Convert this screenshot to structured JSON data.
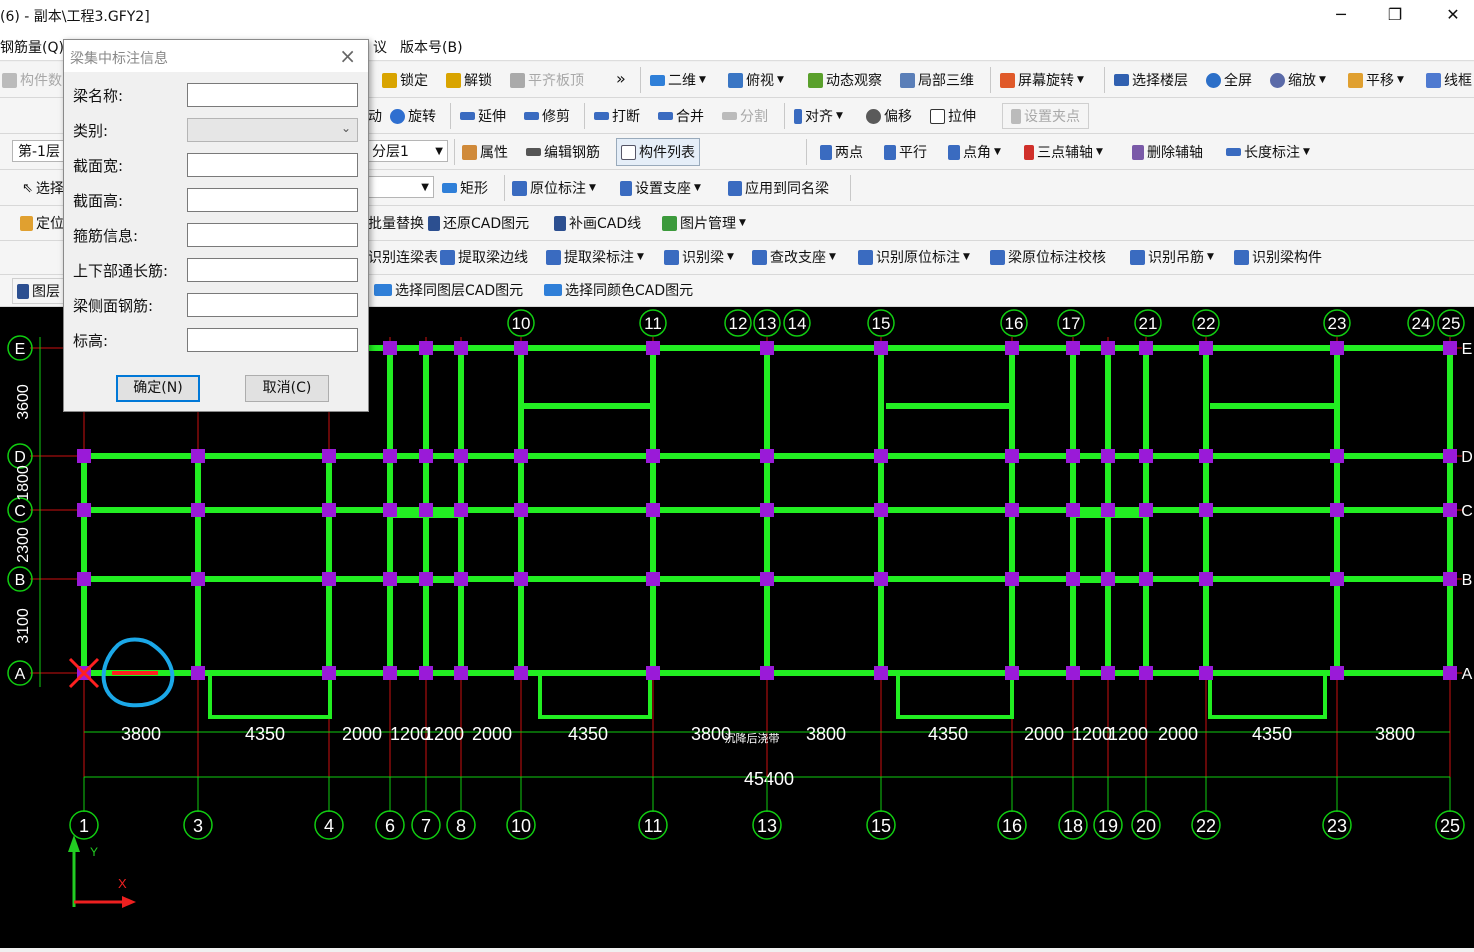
{
  "window": {
    "title": "(6) - 副本\\工程3.GFY2]",
    "minimize": "─",
    "maximize": "❐",
    "close": "✕"
  },
  "menu": {
    "items": [
      {
        "label": "钢筋量(Q)"
      },
      {
        "label": "议"
      },
      {
        "label": "版本号(B)"
      }
    ]
  },
  "toolbar1": {
    "component_data": "构件数",
    "lock": "锁定",
    "unlock": "解锁",
    "flush_top": "平齐板顶",
    "more": "»",
    "view_2d": "二维",
    "top_view": "俯视",
    "dynamic_view": "动态观察",
    "local_3d": "局部三维",
    "screen_rotate": "屏幕旋转",
    "select_floor": "选择楼层",
    "full_screen": "全屏",
    "zoom": "缩放",
    "pan": "平移",
    "wireframe": "线框"
  },
  "toolbar2": {
    "move": "动",
    "rotate": "旋转",
    "extend": "延伸",
    "trim": "修剪",
    "break": "打断",
    "merge": "合并",
    "split": "分割",
    "align": "对齐",
    "offset": "偏移",
    "stretch": "拉伸",
    "set_grip": "设置夹点"
  },
  "toolbar3": {
    "floor": "第-1层",
    "layer": "分层1",
    "properties": "属性",
    "edit_rebar": "编辑钢筋",
    "component_list": "构件列表",
    "two_points": "两点",
    "parallel": "平行",
    "point_angle": "点角",
    "three_point_axis": "三点辅轴",
    "delete_aux": "删除辅轴",
    "length_dim": "长度标注"
  },
  "toolbar4": {
    "select": "选择",
    "rect": "矩形",
    "in_situ_dim": "原位标注",
    "set_support": "设置支座",
    "apply_same_name": "应用到同名梁"
  },
  "toolbar5": {
    "locate": "定位",
    "batch_replace": "批量替换",
    "restore_cad": "还原CAD图元",
    "redraw_cad": "补画CAD线",
    "image_mgmt": "图片管理"
  },
  "toolbar6": {
    "identify_beam_table": "识别连梁表",
    "extract_beam_edge": "提取梁边线",
    "extract_beam_dim": "提取梁标注",
    "identify_beam": "识别梁",
    "check_support": "查改支座",
    "identify_in_situ": "识别原位标注",
    "check_in_situ": "梁原位标注校核",
    "identify_hanger": "识别吊筋",
    "identify_beam_member": "识别梁构件"
  },
  "toolbar7": {
    "layer_tab": "图层",
    "select_same_layer": "选择同图层CAD图元",
    "select_same_color": "选择同颜色CAD图元"
  },
  "dialog": {
    "title": "梁集中标注信息",
    "fields": [
      {
        "label": "梁名称:",
        "value": ""
      },
      {
        "label": "类别:",
        "value": ""
      },
      {
        "label": "截面宽:",
        "value": ""
      },
      {
        "label": "截面高:",
        "value": ""
      },
      {
        "label": "箍筋信息:",
        "value": ""
      },
      {
        "label": "上下部通长筋:",
        "value": ""
      },
      {
        "label": "梁侧面钢筋:",
        "value": ""
      },
      {
        "label": "标高:",
        "value": ""
      }
    ],
    "ok": "确定(N)",
    "cancel": "取消(C)"
  },
  "drawing": {
    "row_axes": [
      "E",
      "D",
      "C",
      "B",
      "A"
    ],
    "row_dims": [
      "3600",
      "1800",
      "2300",
      "3100"
    ],
    "top_axis_labels": [
      "10",
      "11",
      "12",
      "13",
      "14",
      "15",
      "16",
      "17",
      "21",
      "22",
      "23",
      "24",
      "25"
    ],
    "bottom_axis_labels": [
      "1",
      "3",
      "4",
      "6",
      "7",
      "8",
      "10",
      "11",
      "13",
      "15",
      "16",
      "18",
      "19",
      "20",
      "22",
      "23",
      "25"
    ],
    "bottom_dims": [
      "3800",
      "4350",
      "2000",
      "1200",
      "1200",
      "2000",
      "4350",
      "3800",
      "3800",
      "4350",
      "2000",
      "1200",
      "1200",
      "2000",
      "4350",
      "3800"
    ],
    "total_dim": "45400",
    "note": "沉降后浇带",
    "ucs_y": "Y",
    "ucs_x": "X",
    "colors": {
      "wall": "#22ee22",
      "column": "#9a1ad8",
      "axis": "#cc1111",
      "grid": "#11cc11",
      "highlight": "#1ba8e8"
    }
  }
}
